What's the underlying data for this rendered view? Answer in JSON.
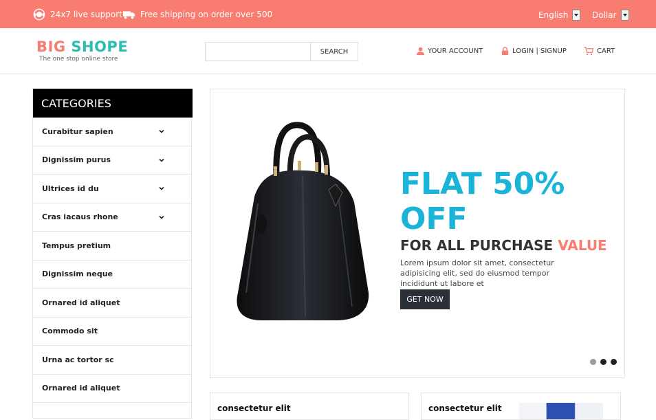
{
  "topbar": {
    "support_text": "24x7 live support",
    "shipping_text": "Free shipping on order over 500",
    "language": "English",
    "currency": "Dollar"
  },
  "header": {
    "logo_part1": "BIG",
    "logo_part2": "SHOPE",
    "tagline": "The one stop online store",
    "search_placeholder": "",
    "search_label": "SEARCH",
    "account_label": "YOUR ACCOUNT",
    "login_label": "LOGIN | SIGNUP",
    "cart_label": "CART"
  },
  "sidebar": {
    "title": "CATEGORIES",
    "items": [
      {
        "label": "Curabitur sapien",
        "has_submenu": true
      },
      {
        "label": "Dignissim purus",
        "has_submenu": true
      },
      {
        "label": "Ultrices id du",
        "has_submenu": true
      },
      {
        "label": "Cras iacaus rhone",
        "has_submenu": true
      },
      {
        "label": "Tempus pretium",
        "has_submenu": false
      },
      {
        "label": "Dignissim neque",
        "has_submenu": false
      },
      {
        "label": "Ornared id aliquet",
        "has_submenu": false
      },
      {
        "label": "Commodo sit",
        "has_submenu": false
      },
      {
        "label": "Urna ac tortor sc",
        "has_submenu": false
      },
      {
        "label": "Ornared id aliquet",
        "has_submenu": false
      }
    ]
  },
  "banner": {
    "headline": "FLAT 50% OFF",
    "subheadline_part1": "FOR ALL PURCHASE",
    "subheadline_part2": "VALUE",
    "description": "Lorem ipsum dolor sit amet, consectetur adipisicing elit, sed do eiusmod tempor incididunt ut labore et",
    "cta_label": "GET NOW",
    "slides": 3,
    "active_slide": 1
  },
  "products": [
    {
      "title": "consectetur elit"
    },
    {
      "title": "consectetur elit"
    }
  ],
  "colors": {
    "accent": "#f87c70",
    "teal": "#2cbcb0",
    "headline_blue": "#1ab4d8",
    "dark_button": "#2b2f38"
  }
}
